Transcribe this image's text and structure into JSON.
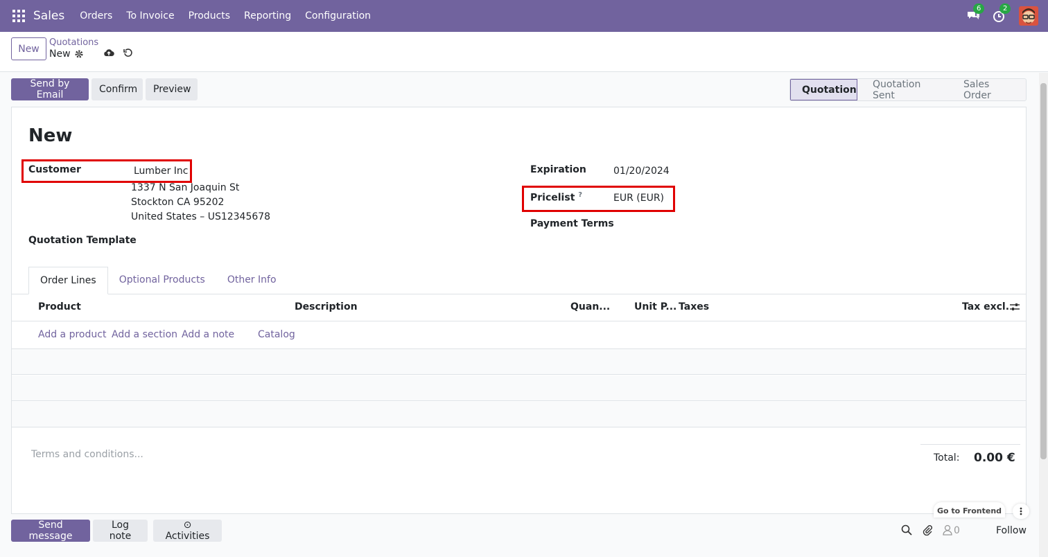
{
  "navbar": {
    "brand": "Sales",
    "menu": [
      "Orders",
      "To Invoice",
      "Products",
      "Reporting",
      "Configuration"
    ],
    "messages_count": "6",
    "activities_count": "2"
  },
  "control_panel": {
    "new_label": "New",
    "breadcrumb_parent": "Quotations",
    "breadcrumb_current": "New"
  },
  "actions": {
    "send_email": "Send by Email",
    "confirm": "Confirm",
    "preview": "Preview"
  },
  "statusbar": [
    "Quotation",
    "Quotation Sent",
    "Sales Order"
  ],
  "form": {
    "title": "New",
    "customer_label": "Customer",
    "customer_name": "Lumber Inc",
    "address_line1": "1337 N San Joaquin St",
    "address_line2": "Stockton CA 95202",
    "address_line3": "United States – US12345678",
    "quotation_template_label": "Quotation Template",
    "expiration_label": "Expiration",
    "expiration_value": "01/20/2024",
    "pricelist_label": "Pricelist",
    "pricelist_help": "?",
    "pricelist_value": "EUR (EUR)",
    "payment_terms_label": "Payment Terms"
  },
  "tabs": [
    "Order Lines",
    "Optional Products",
    "Other Info"
  ],
  "table": {
    "headers": {
      "product": "Product",
      "description": "Description",
      "quantity": "Quan...",
      "unit_price": "Unit P...",
      "taxes": "Taxes",
      "tax_excl": "Tax excl."
    },
    "add_product": "Add a product",
    "add_section": "Add a section",
    "add_note": "Add a note",
    "catalog": "Catalog"
  },
  "footer": {
    "terms_placeholder": "Terms and conditions...",
    "total_label": "Total:",
    "total_value": "0.00 €",
    "go_frontend": "Go to Frontend"
  },
  "chatter": {
    "send_message": "Send message",
    "log_note": "Log note",
    "activities": "Activities",
    "followers_count": "0",
    "follow": "Follow"
  },
  "colors": {
    "brand": "#71639e",
    "highlight": "#e00000"
  }
}
